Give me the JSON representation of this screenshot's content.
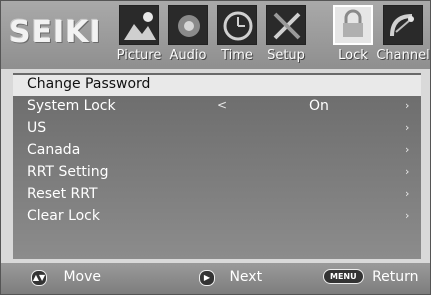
{
  "brand": "SEIKI",
  "tabs": [
    {
      "label": "Picture",
      "icon": "picture-icon"
    },
    {
      "label": "Audio",
      "icon": "audio-icon"
    },
    {
      "label": "Time",
      "icon": "clock-icon"
    },
    {
      "label": "Setup",
      "icon": "setup-icon"
    },
    {
      "label": "Lock",
      "icon": "lock-icon",
      "active": true
    },
    {
      "label": "Channel",
      "icon": "satellite-dish-icon"
    }
  ],
  "menu": {
    "items": [
      {
        "label": "Change Password",
        "selected": true
      },
      {
        "label": "System Lock",
        "value": "On",
        "left_arrow": "<",
        "right_arrow": "›"
      },
      {
        "label": "US",
        "right_arrow": "›"
      },
      {
        "label": "Canada",
        "right_arrow": "›"
      },
      {
        "label": "RRT Setting",
        "right_arrow": "›"
      },
      {
        "label": "Reset RRT",
        "right_arrow": "›"
      },
      {
        "label": "Clear Lock",
        "right_arrow": "›"
      }
    ]
  },
  "footer": {
    "move_label": "Move",
    "next_label": "Next",
    "menu_key": "MENU",
    "return_label": "Return"
  },
  "colors": {
    "topbar": "#9a9a9a",
    "menu_bg": "#757575",
    "selection": "#e9e9e9",
    "text": "#ffffff"
  }
}
